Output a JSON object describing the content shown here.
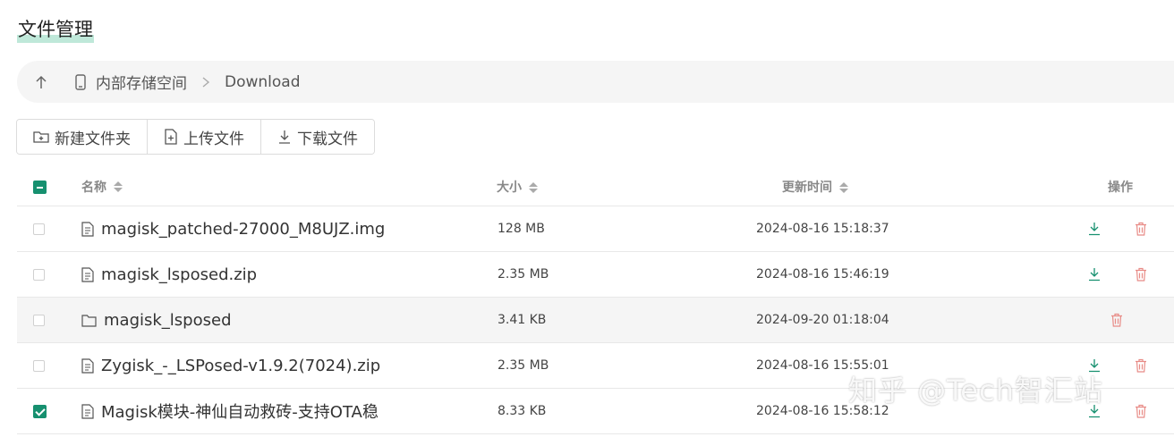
{
  "page": {
    "title": "文件管理"
  },
  "breadcrumb": {
    "root": "内部存储空间",
    "current": "Download"
  },
  "toolbar": {
    "new_folder": "新建文件夹",
    "upload": "上传文件",
    "download": "下载文件"
  },
  "table": {
    "columns": {
      "name": "名称",
      "size": "大小",
      "time": "更新时间",
      "ops": "操作"
    },
    "rows": [
      {
        "name": "magisk_patched-27000_M8UJZ.img",
        "size": "128 MB",
        "time": "2024-08-16 15:18:37",
        "type": "file",
        "checked": false,
        "downloadable": true
      },
      {
        "name": "magisk_lsposed.zip",
        "size": "2.35 MB",
        "time": "2024-08-16 15:46:19",
        "type": "file",
        "checked": false,
        "downloadable": true
      },
      {
        "name": "magisk_lsposed",
        "size": "3.41 KB",
        "time": "2024-09-20 01:18:04",
        "type": "folder",
        "checked": false,
        "downloadable": false
      },
      {
        "name": "Zygisk_-_LSPosed-v1.9.2(7024).zip",
        "size": "2.35 MB",
        "time": "2024-08-16 15:55:01",
        "type": "file",
        "checked": false,
        "downloadable": true
      },
      {
        "name": "Magisk模块-神仙自动救砖-支持OTA稳",
        "size": "8.33 KB",
        "time": "2024-08-16 15:58:12",
        "type": "file",
        "checked": true,
        "downloadable": true
      }
    ]
  },
  "watermark": "知乎 @Tech智汇站",
  "colors": {
    "accent": "#16906f",
    "delete": "#e88b86"
  }
}
